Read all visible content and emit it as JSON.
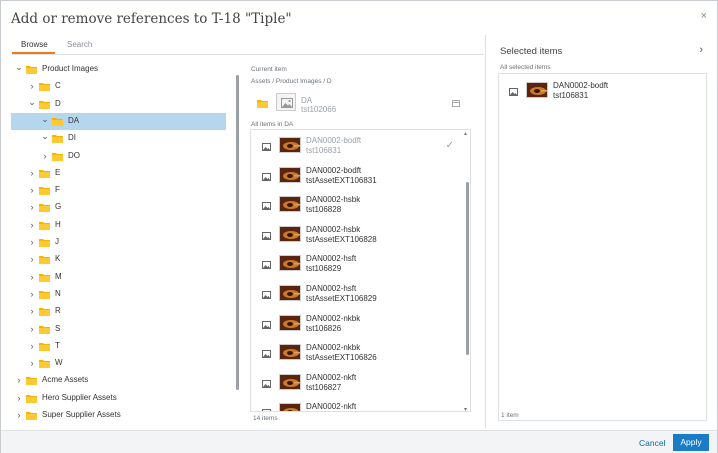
{
  "dialog": {
    "title": "Add or remove references to T-18 \"Tiple\"",
    "close_icon": "×"
  },
  "tabs": [
    {
      "label": "Browse",
      "active": true
    },
    {
      "label": "Search",
      "active": false
    }
  ],
  "tree": [
    {
      "label": "Product Images",
      "expanded": true,
      "depth": 0
    },
    {
      "label": "C",
      "expanded": false,
      "depth": 1
    },
    {
      "label": "D",
      "expanded": true,
      "depth": 1
    },
    {
      "label": "DA",
      "expanded": true,
      "depth": 2,
      "selected": true
    },
    {
      "label": "DI",
      "expanded": true,
      "depth": 2
    },
    {
      "label": "DO",
      "expanded": false,
      "depth": 2
    },
    {
      "label": "E",
      "expanded": false,
      "depth": 1
    },
    {
      "label": "F",
      "expanded": false,
      "depth": 1
    },
    {
      "label": "G",
      "expanded": false,
      "depth": 1
    },
    {
      "label": "H",
      "expanded": false,
      "depth": 1
    },
    {
      "label": "J",
      "expanded": false,
      "depth": 1
    },
    {
      "label": "K",
      "expanded": false,
      "depth": 1
    },
    {
      "label": "M",
      "expanded": false,
      "depth": 1
    },
    {
      "label": "N",
      "expanded": false,
      "depth": 1
    },
    {
      "label": "R",
      "expanded": false,
      "depth": 1
    },
    {
      "label": "S",
      "expanded": false,
      "depth": 1
    },
    {
      "label": "T",
      "expanded": false,
      "depth": 1
    },
    {
      "label": "W",
      "expanded": false,
      "depth": 1
    },
    {
      "label": "Acme Assets",
      "expanded": false,
      "depth": 0
    },
    {
      "label": "Hero Supplier Assets",
      "expanded": false,
      "depth": 0
    },
    {
      "label": "Super Supplier Assets",
      "expanded": false,
      "depth": 0
    }
  ],
  "middle": {
    "current_item_label": "Current item",
    "breadcrumb": "Assets / Product Images / D",
    "current_name": "DA",
    "current_id": "tst102066",
    "all_items_label": "All items in DA",
    "count_label": "14 items",
    "items": [
      {
        "name": "DAN0002-bodft",
        "sub": "tst106831",
        "selected": true
      },
      {
        "name": "DAN0002-bodft",
        "sub": "tstAssetEXT106831"
      },
      {
        "name": "DAN0002-hsbk",
        "sub": "tst106828"
      },
      {
        "name": "DAN0002-hsbk",
        "sub": "tstAssetEXT106828"
      },
      {
        "name": "DAN0002-hsft",
        "sub": "tst106829"
      },
      {
        "name": "DAN0002-hsft",
        "sub": "tstAssetEXT106829"
      },
      {
        "name": "DAN0002-nkbk",
        "sub": "tst106826"
      },
      {
        "name": "DAN0002-nkbk",
        "sub": "tstAssetEXT106826"
      },
      {
        "name": "DAN0002-nkft",
        "sub": "tst106827"
      },
      {
        "name": "DAN0002-nkft",
        "sub": ""
      }
    ]
  },
  "selected": {
    "title": "Selected items",
    "all_label": "All selected items",
    "count_label": "1 item",
    "items": [
      {
        "name": "DAN0002-bodft",
        "sub": "tst106831"
      }
    ]
  },
  "footer": {
    "cancel_label": "Cancel",
    "apply_label": "Apply"
  },
  "colors": {
    "accent": "#f07b1d",
    "primary_button": "#1a7cc7",
    "selection": "#b4d7ee",
    "folder": "#f5b400"
  }
}
